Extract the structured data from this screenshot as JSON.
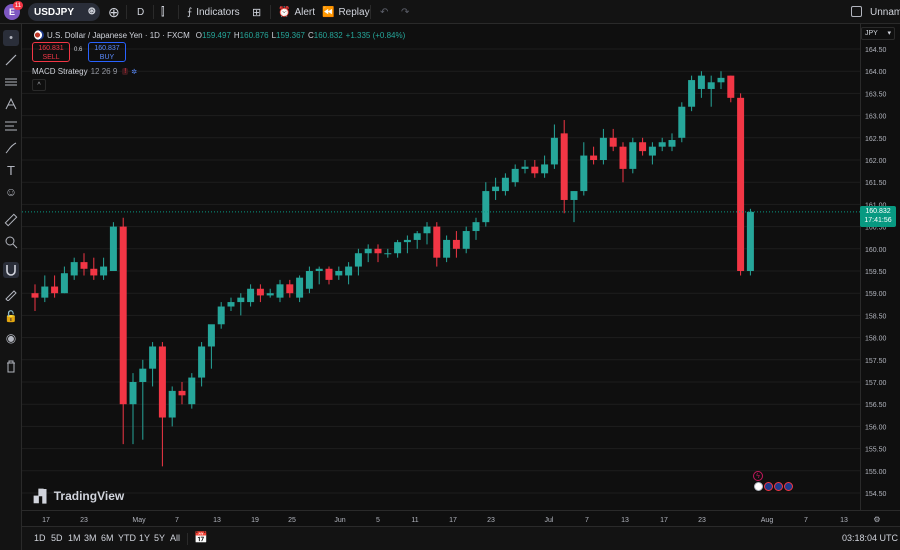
{
  "topbar": {
    "avatar_letter": "E",
    "notifications": "11",
    "symbol": "USDJPY",
    "interval": "D",
    "indicators_label": "Indicators",
    "alert_label": "Alert",
    "replay_label": "Replay",
    "layout_name": "Unname"
  },
  "legend": {
    "title": "U.S. Dollar / Japanese Yen · 1D · FXCM",
    "o_label": "O",
    "o_value": "159.497",
    "h_label": "H",
    "h_value": "160.876",
    "l_label": "L",
    "l_value": "159.367",
    "c_label": "C",
    "c_value": "160.832",
    "change": "+1.335 (+0.84%)"
  },
  "trade": {
    "sell_price": "160.831",
    "sell_label": "SELL",
    "spread": "0.6",
    "buy_price": "160.837",
    "buy_label": "BUY"
  },
  "strategy": {
    "name": "MACD Strategy",
    "params": "12 26 9",
    "error_badge": "!",
    "collapse": "^"
  },
  "logo_text": "TradingView",
  "price_scale": {
    "currency": "JPY",
    "current_price": "160.832",
    "countdown": "17:41:56"
  },
  "bottombar": {
    "ranges": [
      "1D",
      "5D",
      "1M",
      "3M",
      "6M",
      "YTD",
      "1Y",
      "5Y",
      "All"
    ],
    "clock": "03:18:04 UTC"
  },
  "colors": {
    "up": "#26a69a",
    "down": "#f23645",
    "grid": "#1e1e1e",
    "bg": "#0f0f0f"
  },
  "chart_data": {
    "type": "candlestick",
    "symbol": "USDJPY",
    "y_ticks": [
      154.5,
      155.0,
      155.5,
      156.0,
      156.5,
      157.0,
      157.5,
      158.0,
      158.5,
      159.0,
      159.5,
      160.0,
      160.5,
      161.0,
      161.5,
      162.0,
      162.5,
      163.0,
      163.5,
      164.0,
      164.5
    ],
    "ylim": [
      154.3,
      164.7
    ],
    "x_ticks": [
      "17",
      "23",
      "May",
      "7",
      "13",
      "19",
      "25",
      "Jun",
      "5",
      "11",
      "17",
      "23",
      "Jul",
      "7",
      "13",
      "17",
      "23",
      "Aug",
      "7",
      "13"
    ],
    "candles": [
      {
        "o": 159.0,
        "h": 159.2,
        "l": 158.6,
        "c": 158.9
      },
      {
        "o": 158.9,
        "h": 159.4,
        "l": 158.8,
        "c": 159.15
      },
      {
        "o": 159.15,
        "h": 159.4,
        "l": 158.9,
        "c": 159.0
      },
      {
        "o": 159.0,
        "h": 159.6,
        "l": 159.0,
        "c": 159.45
      },
      {
        "o": 159.4,
        "h": 159.8,
        "l": 159.3,
        "c": 159.7
      },
      {
        "o": 159.7,
        "h": 159.9,
        "l": 159.4,
        "c": 159.55
      },
      {
        "o": 159.55,
        "h": 159.8,
        "l": 159.3,
        "c": 159.4
      },
      {
        "o": 159.4,
        "h": 159.8,
        "l": 159.3,
        "c": 159.6
      },
      {
        "o": 159.5,
        "h": 160.6,
        "l": 159.5,
        "c": 160.5
      },
      {
        "o": 160.5,
        "h": 160.7,
        "l": 155.6,
        "c": 156.5
      },
      {
        "o": 156.5,
        "h": 157.2,
        "l": 155.6,
        "c": 157.0
      },
      {
        "o": 157.0,
        "h": 157.5,
        "l": 155.7,
        "c": 157.3
      },
      {
        "o": 157.3,
        "h": 157.9,
        "l": 156.9,
        "c": 157.8
      },
      {
        "o": 157.8,
        "h": 157.9,
        "l": 155.1,
        "c": 156.2
      },
      {
        "o": 156.2,
        "h": 156.9,
        "l": 156.0,
        "c": 156.8
      },
      {
        "o": 156.8,
        "h": 157.0,
        "l": 156.5,
        "c": 156.7
      },
      {
        "o": 156.5,
        "h": 157.2,
        "l": 156.4,
        "c": 157.1
      },
      {
        "o": 157.1,
        "h": 157.9,
        "l": 156.9,
        "c": 157.8
      },
      {
        "o": 157.8,
        "h": 158.1,
        "l": 157.3,
        "c": 158.3
      },
      {
        "o": 158.3,
        "h": 158.8,
        "l": 158.2,
        "c": 158.7
      },
      {
        "o": 158.7,
        "h": 158.9,
        "l": 158.6,
        "c": 158.8
      },
      {
        "o": 158.8,
        "h": 159.0,
        "l": 158.5,
        "c": 158.9
      },
      {
        "o": 158.8,
        "h": 159.2,
        "l": 158.7,
        "c": 159.1
      },
      {
        "o": 159.1,
        "h": 159.2,
        "l": 158.8,
        "c": 158.95
      },
      {
        "o": 158.95,
        "h": 159.1,
        "l": 158.9,
        "c": 159.0
      },
      {
        "o": 158.9,
        "h": 159.3,
        "l": 158.8,
        "c": 159.2
      },
      {
        "o": 159.2,
        "h": 159.3,
        "l": 158.9,
        "c": 159.0
      },
      {
        "o": 158.9,
        "h": 159.4,
        "l": 158.8,
        "c": 159.35
      },
      {
        "o": 159.1,
        "h": 159.6,
        "l": 159.0,
        "c": 159.5
      },
      {
        "o": 159.5,
        "h": 159.6,
        "l": 159.2,
        "c": 159.55
      },
      {
        "o": 159.55,
        "h": 159.6,
        "l": 159.2,
        "c": 159.3
      },
      {
        "o": 159.4,
        "h": 159.6,
        "l": 159.3,
        "c": 159.5
      },
      {
        "o": 159.4,
        "h": 159.7,
        "l": 159.2,
        "c": 159.6
      },
      {
        "o": 159.6,
        "h": 160.0,
        "l": 159.4,
        "c": 159.9
      },
      {
        "o": 159.9,
        "h": 160.1,
        "l": 159.7,
        "c": 160.0
      },
      {
        "o": 160.0,
        "h": 160.1,
        "l": 159.7,
        "c": 159.9
      },
      {
        "o": 159.9,
        "h": 160.0,
        "l": 159.8,
        "c": 159.9
      },
      {
        "o": 159.9,
        "h": 160.2,
        "l": 159.8,
        "c": 160.15
      },
      {
        "o": 160.15,
        "h": 160.3,
        "l": 159.9,
        "c": 160.2
      },
      {
        "o": 160.2,
        "h": 160.4,
        "l": 160.0,
        "c": 160.35
      },
      {
        "o": 160.35,
        "h": 160.6,
        "l": 160.1,
        "c": 160.5
      },
      {
        "o": 160.5,
        "h": 160.6,
        "l": 159.6,
        "c": 159.8
      },
      {
        "o": 159.8,
        "h": 160.3,
        "l": 159.7,
        "c": 160.2
      },
      {
        "o": 160.2,
        "h": 160.4,
        "l": 159.8,
        "c": 160.0
      },
      {
        "o": 160.0,
        "h": 160.5,
        "l": 159.9,
        "c": 160.4
      },
      {
        "o": 160.4,
        "h": 160.7,
        "l": 160.2,
        "c": 160.6
      },
      {
        "o": 160.6,
        "h": 161.5,
        "l": 160.5,
        "c": 161.3
      },
      {
        "o": 161.3,
        "h": 161.6,
        "l": 161.1,
        "c": 161.4
      },
      {
        "o": 161.3,
        "h": 161.7,
        "l": 161.2,
        "c": 161.6
      },
      {
        "o": 161.5,
        "h": 161.9,
        "l": 161.4,
        "c": 161.8
      },
      {
        "o": 161.8,
        "h": 162.0,
        "l": 161.7,
        "c": 161.85
      },
      {
        "o": 161.85,
        "h": 162.0,
        "l": 161.6,
        "c": 161.7
      },
      {
        "o": 161.7,
        "h": 162.1,
        "l": 161.6,
        "c": 161.9
      },
      {
        "o": 161.9,
        "h": 162.8,
        "l": 161.8,
        "c": 162.5
      },
      {
        "o": 162.6,
        "h": 162.9,
        "l": 160.8,
        "c": 161.1
      },
      {
        "o": 161.1,
        "h": 161.3,
        "l": 160.6,
        "c": 161.3
      },
      {
        "o": 161.3,
        "h": 162.4,
        "l": 161.2,
        "c": 162.1
      },
      {
        "o": 162.1,
        "h": 162.3,
        "l": 161.9,
        "c": 162.0
      },
      {
        "o": 162.0,
        "h": 162.7,
        "l": 161.9,
        "c": 162.5
      },
      {
        "o": 162.5,
        "h": 162.7,
        "l": 162.2,
        "c": 162.3
      },
      {
        "o": 162.3,
        "h": 162.4,
        "l": 161.5,
        "c": 161.8
      },
      {
        "o": 161.8,
        "h": 162.5,
        "l": 161.7,
        "c": 162.4
      },
      {
        "o": 162.4,
        "h": 162.5,
        "l": 162.1,
        "c": 162.2
      },
      {
        "o": 162.1,
        "h": 162.4,
        "l": 161.9,
        "c": 162.3
      },
      {
        "o": 162.3,
        "h": 162.5,
        "l": 162.2,
        "c": 162.4
      },
      {
        "o": 162.3,
        "h": 162.6,
        "l": 162.2,
        "c": 162.45
      },
      {
        "o": 162.5,
        "h": 163.3,
        "l": 162.4,
        "c": 163.2
      },
      {
        "o": 163.2,
        "h": 163.9,
        "l": 163.1,
        "c": 163.8
      },
      {
        "o": 163.6,
        "h": 164.0,
        "l": 163.4,
        "c": 163.9
      },
      {
        "o": 163.6,
        "h": 163.9,
        "l": 163.2,
        "c": 163.75
      },
      {
        "o": 163.75,
        "h": 164.0,
        "l": 163.6,
        "c": 163.85
      },
      {
        "o": 163.9,
        "h": 163.9,
        "l": 163.3,
        "c": 163.4
      },
      {
        "o": 163.4,
        "h": 163.5,
        "l": 159.4,
        "c": 159.5
      },
      {
        "o": 159.5,
        "h": 160.9,
        "l": 159.4,
        "c": 160.832
      }
    ]
  }
}
